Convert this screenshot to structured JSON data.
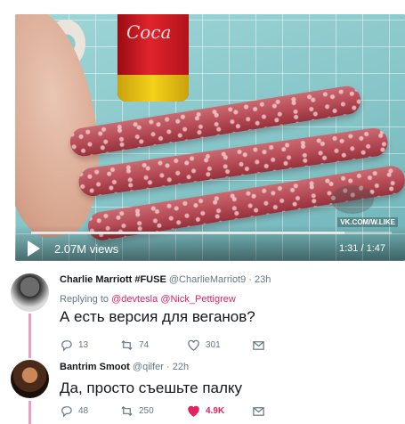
{
  "video": {
    "views": "2.07M views",
    "time": "1:31 / 1:47",
    "progress": 0.87,
    "watermark": "VK.COM/W.LIKE"
  },
  "tweet1": {
    "name": "Charlie Marriott #FUSE",
    "handle": "@CharlieMarriot9",
    "time": "· 23h",
    "replying_prefix": "Replying to",
    "mention1": "@devtesla",
    "mention2": "@Nick_Pettigrew",
    "text": "А есть версия для веганов?",
    "replies": "13",
    "retweets": "74",
    "likes": "301"
  },
  "tweet2": {
    "name": "Bantrim Smoot",
    "handle": "@qilfer",
    "time": "· 22h",
    "text": "Да, просто съешьте палку",
    "replies": "48",
    "retweets": "250",
    "likes": "4.9K"
  },
  "icons": {
    "reply": "reply-icon",
    "retweet": "retweet-icon",
    "like": "heart-icon",
    "dm": "envelope-icon",
    "play": "play-icon"
  },
  "colors": {
    "accent": "#e0245e",
    "muted": "#657786",
    "thread": "#e8a0c3"
  }
}
